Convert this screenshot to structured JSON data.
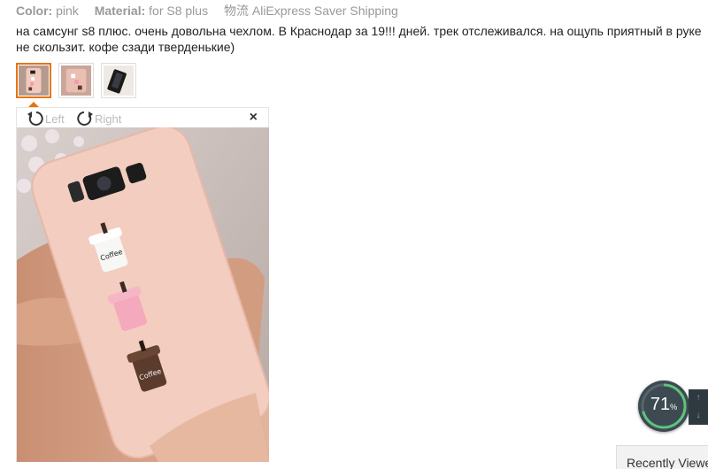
{
  "meta": {
    "color_label": "Color:",
    "color_value": "pink",
    "material_label": "Material:",
    "material_value": "for S8 plus",
    "logistics": "物流 AliExpress Saver Shipping"
  },
  "review": {
    "text": "на самсунг s8 плюс. очень довольна чехлом. В Краснодар за 19!!! дней. трек отслеживался. на ощупь приятный в руке не скользит. кофе сзади тверденькие)"
  },
  "thumbnails": [
    {
      "icon": "photo-thumbnail-1",
      "active": true
    },
    {
      "icon": "photo-thumbnail-2",
      "active": false
    },
    {
      "icon": "photo-thumbnail-3",
      "active": false
    }
  ],
  "viewer": {
    "rotate_left_label": "Left",
    "rotate_right_label": "Right",
    "close_glyph": "×",
    "photo_icon": "phone-case-photo"
  },
  "widget": {
    "gauge_value": "71",
    "gauge_unit": "%",
    "gauge_fraction": 0.71,
    "up_glyph": "↑",
    "down_glyph": "↓"
  },
  "recently_viewed": {
    "label": "Recently Viewed"
  },
  "colors": {
    "accent": "#e8740c",
    "case_pink": "#f1c9bd",
    "gauge_bg": "#3d4a52"
  }
}
